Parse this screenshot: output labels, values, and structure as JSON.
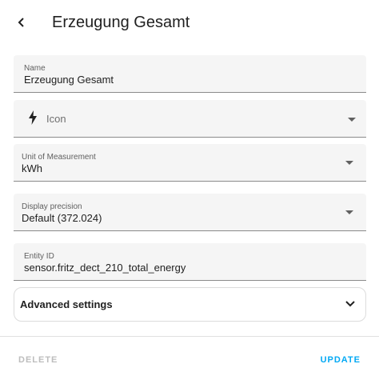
{
  "header": {
    "title": "Erzeugung Gesamt"
  },
  "fields": {
    "name": {
      "label": "Name",
      "value": "Erzeugung Gesamt"
    },
    "icon": {
      "placeholder": "Icon",
      "icon": "lightning-bolt-icon"
    },
    "unit": {
      "label": "Unit of Measurement",
      "value": "kWh"
    },
    "precision": {
      "label": "Display precision",
      "value": "Default (372.024)"
    },
    "entity_id": {
      "label": "Entity ID",
      "value": "sensor.fritz_dect_210_total_energy"
    }
  },
  "advanced": {
    "label": "Advanced settings"
  },
  "footer": {
    "delete_label": "DELETE",
    "update_label": "UPDATE"
  },
  "colors": {
    "accent": "#03a9f4",
    "disabled": "#bdbdbd",
    "field_bg": "#f5f5f5"
  }
}
